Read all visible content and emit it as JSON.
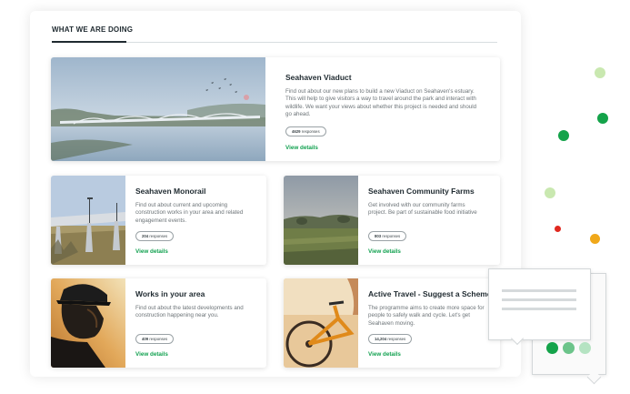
{
  "section": {
    "title": "WHAT WE ARE DOING"
  },
  "cards": [
    {
      "title": "Seahaven Viaduct",
      "description": "Find out about our new plans to build a new Viaduct on Seahaven's estuary. This will help to give visitors a way to travel around the park and interact with wildlife. We want your views about whether this project is needed and should go ahead.",
      "count": "4629",
      "count_suffix": "responses",
      "link": "View details"
    },
    {
      "title": "Seahaven Monorail",
      "description": "Find out about current and upcoming construction works in your area and related engagement events.",
      "count": "204",
      "count_suffix": "responses",
      "link": "View details"
    },
    {
      "title": "Seahaven Community Farms",
      "description": "Get involved with our community farms project. Be part of sustainable food initiative",
      "count": "803",
      "count_suffix": "responses",
      "link": "View details"
    },
    {
      "title": "Works in your area",
      "description": "Find out about the latest developments and construction happening near you.",
      "count": "409",
      "count_suffix": "responses",
      "link": "View details"
    },
    {
      "title": "Active Travel - Suggest a Scheme",
      "description": "The programme aims to create more space for people to safely walk and cycle. Let's get Seahaven moving.",
      "count": "14,204",
      "count_suffix": "responses",
      "link": "View details"
    }
  ],
  "colors": {
    "link_green": "#12a150",
    "dot_green": "#14a34a",
    "dot_light_green": "#c9e8b0",
    "dot_red": "#e0281f",
    "dot_orange": "#f0a81a"
  },
  "icons": [
    "speech-bubble-icon",
    "typing-dots-icon"
  ]
}
